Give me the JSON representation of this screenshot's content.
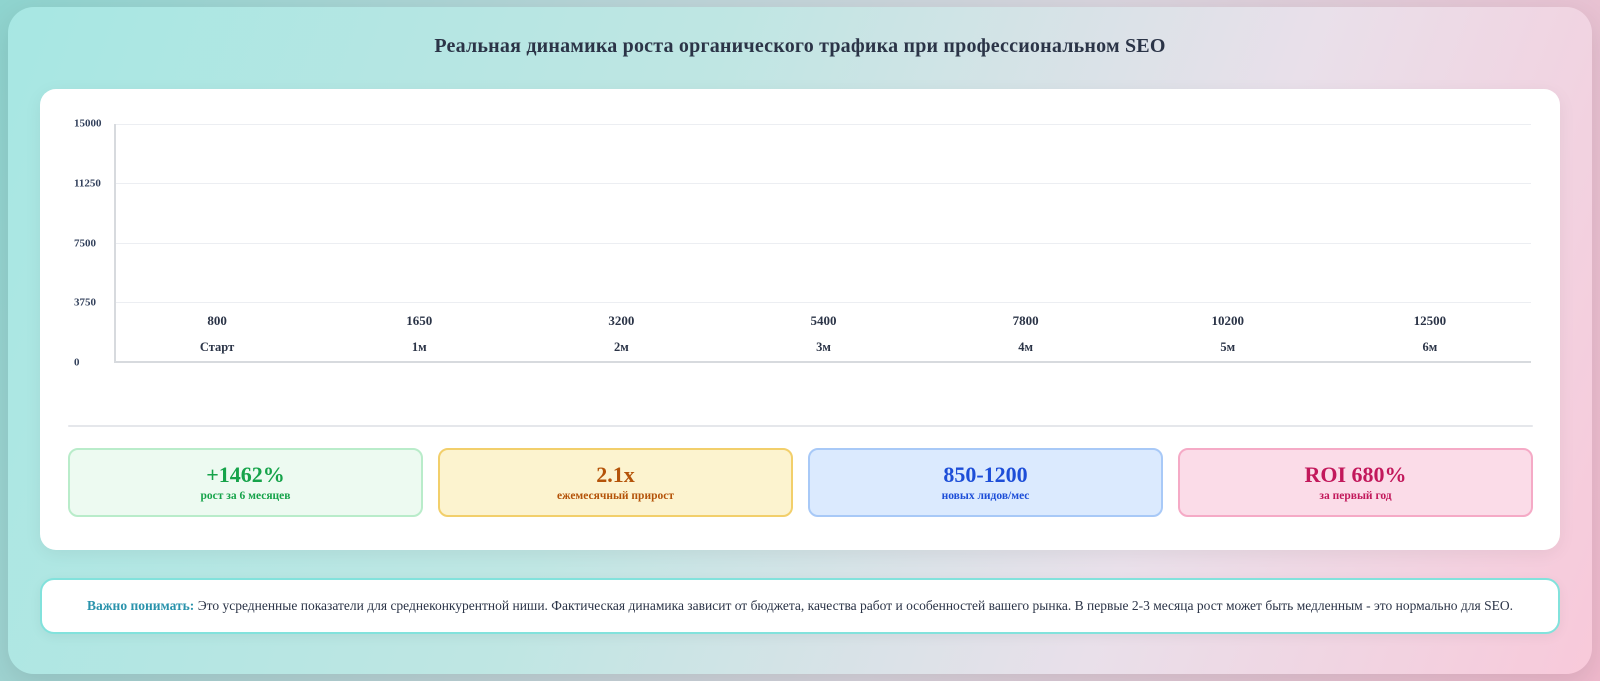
{
  "page": {
    "title": "Реальная динамика роста органического трафика при профессиональном SEO"
  },
  "chart_data": {
    "type": "bar",
    "title": "Реальная динамика роста органического трафика при профессиональном SEO",
    "categories": [
      "Старт",
      "1м",
      "2м",
      "3м",
      "4м",
      "5м",
      "6м"
    ],
    "values": [
      800,
      1650,
      3200,
      5400,
      7800,
      10200,
      12500
    ],
    "y_ticks": [
      15000,
      11250,
      7500,
      3750,
      0
    ],
    "ylim": [
      0,
      15000
    ],
    "xlabel": "",
    "ylabel": "",
    "grid": true,
    "legend": "none",
    "bars_visible": false,
    "value_labels_shown": true
  },
  "stats": [
    {
      "id": "growth",
      "value": "+1462%",
      "label": "рост за 6 месяцев",
      "color": "#16a34a",
      "bg": "#edfaf1",
      "border": "#b9ecca"
    },
    {
      "id": "monthly",
      "value": "2.1x",
      "label": "ежемесячный прирост",
      "color": "#b45309",
      "bg": "#fcf3cf",
      "border": "#f2cf6b"
    },
    {
      "id": "leads",
      "value": "850-1200",
      "label": "новых лидов/мес",
      "color": "#1d4ed8",
      "bg": "#dbeafe",
      "border": "#a8c9f7"
    },
    {
      "id": "roi",
      "value": "ROI 680%",
      "label": "за первый год",
      "color": "#c2185b",
      "bg": "#fbdce8",
      "border": "#f5aac6"
    }
  ],
  "note": {
    "lead": "Важно понимать:",
    "text": "Это усредненные показатели для среднеконкурентной ниши. Фактическая динамика зависит от бюджета, качества работ и особенностей вашего рынка. В первые 2-3 месяца рост может быть медленным - это нормально для SEO."
  },
  "theme": {
    "bg_gradient_start": "#a7e7e3",
    "bg_gradient_end": "#f8c9da",
    "title_color": "#2b3447",
    "axis_color": "#d7dade",
    "gridline_color": "#eceef2",
    "note_border_color": "#82e2dc",
    "note_lead_color": "#2a93ac"
  }
}
